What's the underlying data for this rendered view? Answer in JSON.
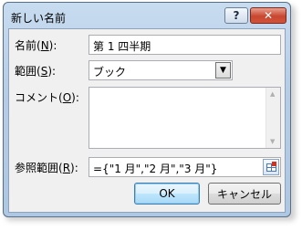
{
  "window": {
    "title": "新しい名前",
    "help_label": "?",
    "close_label": "✕"
  },
  "form": {
    "name": {
      "label": "名前(",
      "key": "N",
      "suffix": "):",
      "value": "第 1 四半期"
    },
    "scope": {
      "label": "範囲(",
      "key": "S",
      "suffix": "):",
      "value": "ブック"
    },
    "comment": {
      "label": "コメント(",
      "key": "O",
      "suffix": "):",
      "value": ""
    },
    "refers_to": {
      "label": "参照範囲(",
      "key": "R",
      "suffix": "):",
      "value": "={\"1 月\",\"2 月\",\"3 月\"}"
    }
  },
  "buttons": {
    "ok": "OK",
    "cancel": "キャンセル"
  },
  "icons": {
    "combo_arrow": "chevron-down-icon",
    "refedit": "range-select-icon"
  },
  "colors": {
    "frame": "#b6cde6",
    "client": "#f0f0f0",
    "close_button": "#c8462f",
    "ok_button": "#bee6fd"
  }
}
